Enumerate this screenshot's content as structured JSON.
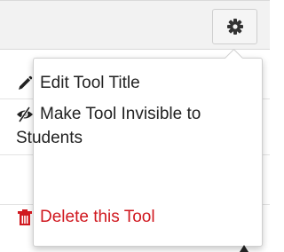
{
  "header": {
    "gear_icon": "gear-icon"
  },
  "menu": {
    "items": [
      {
        "label": "Edit Tool Title",
        "icon": "pencil-icon"
      },
      {
        "label": "Make Tool Invisible to Students",
        "icon": "eye-slash-icon"
      },
      {
        "label": "Delete this Tool",
        "icon": "trash-icon",
        "color": "#d0181f"
      }
    ]
  }
}
